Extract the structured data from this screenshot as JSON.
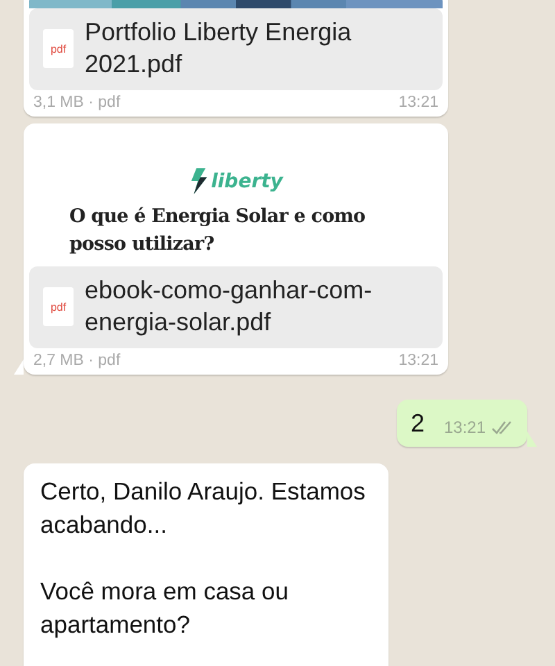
{
  "messages": [
    {
      "kind": "document",
      "outgoing": false,
      "file_name": "Portfolio Liberty Energia 2021.pdf",
      "file_type": "pdf",
      "file_info": "3,1 MB · pdf",
      "time": "13:21",
      "tail": false
    },
    {
      "kind": "document",
      "outgoing": false,
      "preview": {
        "kind": "page",
        "logo": "liberty",
        "heading": "O que é Energia Solar e como posso utilizar?"
      },
      "file_name": "ebook-como-ganhar-com-energia-solar.pdf",
      "file_type": "pdf",
      "file_info": "2,7 MB · pdf",
      "time": "13:21",
      "tail": true
    },
    {
      "kind": "text",
      "outgoing": true,
      "text": "2",
      "time": "13:21",
      "read": false,
      "tail": true
    },
    {
      "kind": "text",
      "outgoing": false,
      "paragraphs": [
        "Certo, Danilo Araujo. Estamos acabando...",
        "Você mora em casa ou apartamento?"
      ],
      "tail": false
    }
  ]
}
